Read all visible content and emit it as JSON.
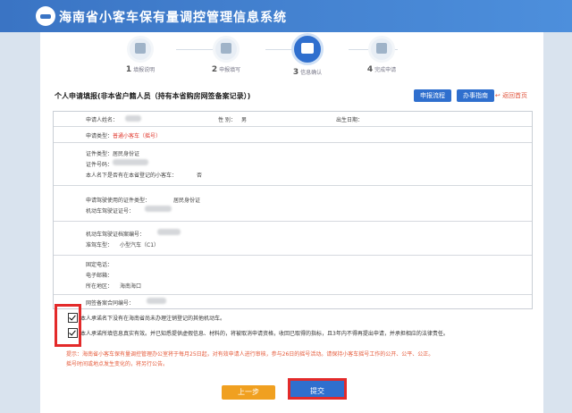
{
  "app": {
    "title": "海南省小客车保有量调控管理信息系统"
  },
  "steps": [
    {
      "num": "1",
      "label": "填报说明"
    },
    {
      "num": "2",
      "label": "申报填写"
    },
    {
      "num": "3",
      "label": "信息确认"
    },
    {
      "num": "4",
      "label": "完成申请"
    }
  ],
  "form": {
    "title": "个人申请填报(非本省户籍人员（持有本省购房网签备案记录）)",
    "btn_flow": "申报流程",
    "btn_guide": "办事指南",
    "back": "返回首页",
    "applicant_label": "申请人姓名：",
    "gender_label": "性 别：",
    "gender_value": "男",
    "birth_label": "出生日期：",
    "apply_type_label": "申请类型：",
    "apply_type_value": "普通小客车（摇号）",
    "id_type_label": "证件类型：",
    "id_type_value": "居民身份证",
    "id_num_label": "证件号码：",
    "existing_label": "本人名下是否有在本省登记的小客车：",
    "existing_value": "否",
    "license_type_label": "申请驾驶使用的证件类型：",
    "license_type_value": "居民身份证",
    "driver_id_label": "机动车驾驶证证号：",
    "file_num_label": "机动车驾驶证档案编号：",
    "vehicle_class_label": "准驾车型：",
    "vehicle_class_value": "小型汽车（C1）",
    "phone_label": "固定电话：",
    "email_label": "电子邮箱：",
    "region_label": "所在地区：",
    "region_value": "海南海口",
    "contract_label": "网签备案合同编号："
  },
  "checks": [
    {
      "text": "本人承诺名下没有在海南省尚未办理注销登记的其他机动车。"
    },
    {
      "text": "本人承诺所填信息真实有效。并已知悉提供虚假信息、材料的，将被取消申请资格，收回已取得的指标，且3年内不得再提出申请，并承担相应的法律责任。"
    }
  ],
  "notice": [
    "提示：海南省小客车保有量调控管理办公室将于每月25日起，对有效申请人进行审核，参与26日的摇号活动。请保持小客车摇号工作的公开、公平、公正。",
    "摇号时间或地点发生变化的，将另行公告。"
  ],
  "buttons": {
    "prev": "上一步",
    "submit": "提交"
  }
}
